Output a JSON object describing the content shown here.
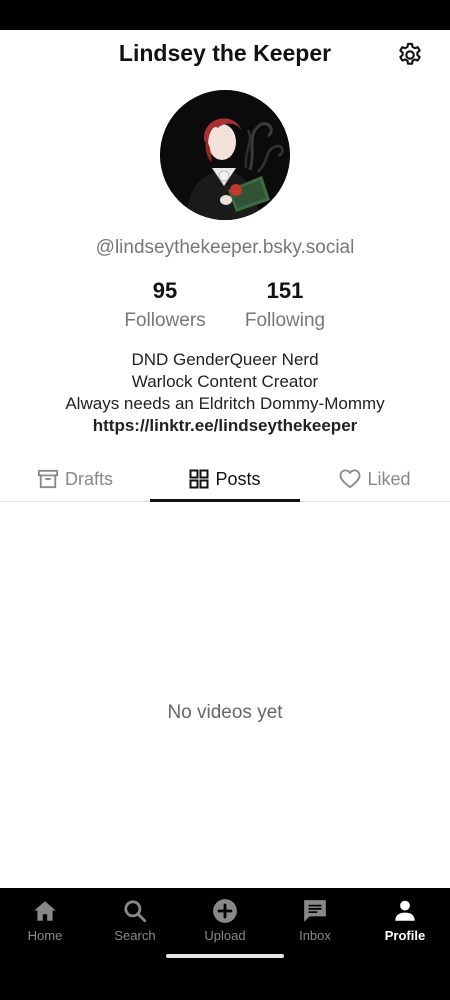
{
  "header": {
    "title": "Lindsey the Keeper"
  },
  "profile": {
    "handle": "@lindseythekeeper.bsky.social",
    "stats": {
      "followers_count": "95",
      "followers_label": "Followers",
      "following_count": "151",
      "following_label": "Following"
    },
    "bio": {
      "line1": "DND GenderQueer Nerd",
      "line2": "Warlock Content Creator",
      "line3": "Always needs an Eldritch Dommy-Mommy",
      "link": "https://linktr.ee/lindseythekeeper"
    }
  },
  "tabs": [
    {
      "label": "Drafts",
      "icon": "archive-icon"
    },
    {
      "label": "Posts",
      "icon": "grid-icon"
    },
    {
      "label": "Liked",
      "icon": "heart-icon"
    }
  ],
  "active_tab": "Posts",
  "empty_state": "No videos yet",
  "bottom_nav": [
    {
      "label": "Home",
      "icon": "home-icon"
    },
    {
      "label": "Search",
      "icon": "search-icon"
    },
    {
      "label": "Upload",
      "icon": "add-circle-icon"
    },
    {
      "label": "Inbox",
      "icon": "message-icon"
    },
    {
      "label": "Profile",
      "icon": "person-icon"
    }
  ],
  "active_nav": "Profile",
  "colors": {
    "background": "#ffffff",
    "nav_background": "#000000",
    "muted_text": "#777777",
    "active_text": "#111111"
  }
}
